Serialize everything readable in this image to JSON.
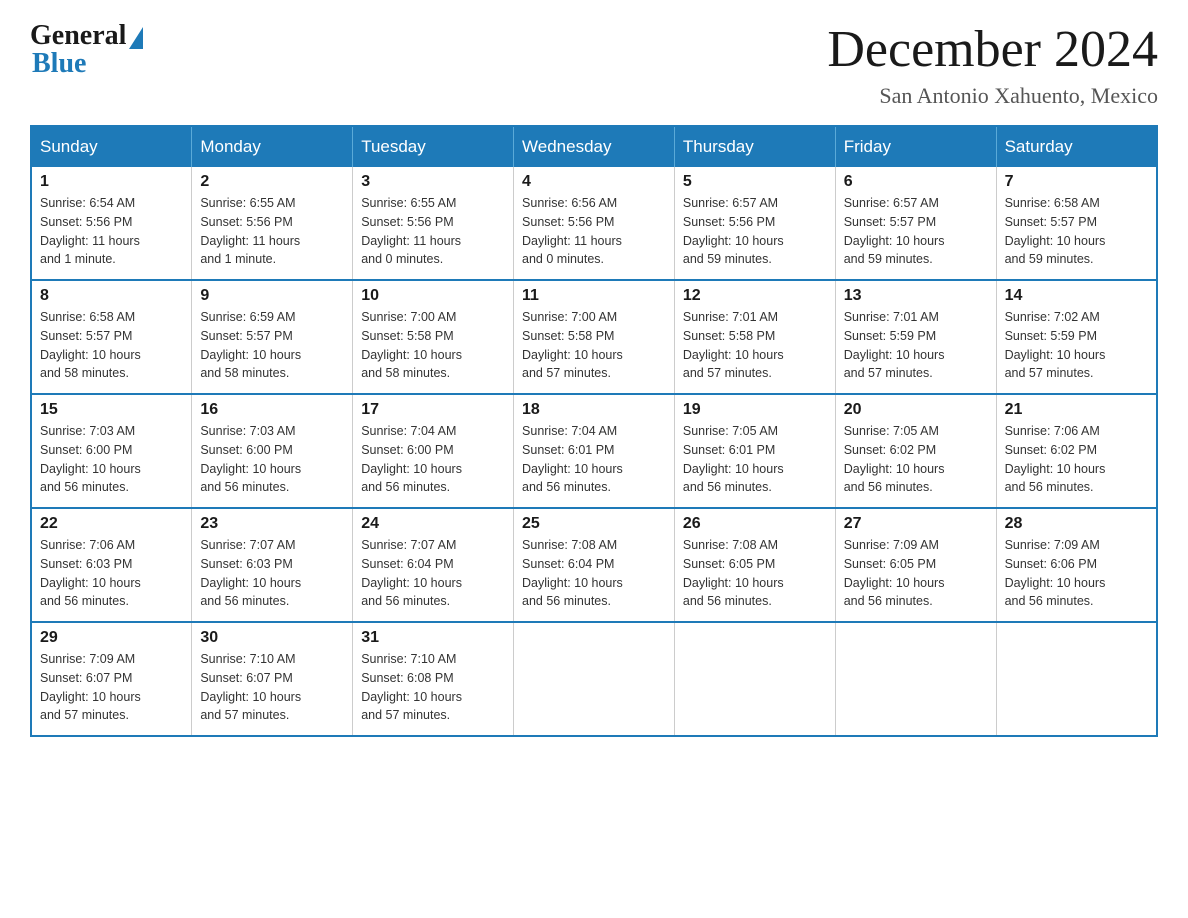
{
  "logo": {
    "general": "General",
    "blue": "Blue"
  },
  "title": {
    "month": "December 2024",
    "location": "San Antonio Xahuento, Mexico"
  },
  "headers": [
    "Sunday",
    "Monday",
    "Tuesday",
    "Wednesday",
    "Thursday",
    "Friday",
    "Saturday"
  ],
  "weeks": [
    [
      {
        "day": "1",
        "sunrise": "6:54 AM",
        "sunset": "5:56 PM",
        "daylight": "11 hours and 1 minute."
      },
      {
        "day": "2",
        "sunrise": "6:55 AM",
        "sunset": "5:56 PM",
        "daylight": "11 hours and 1 minute."
      },
      {
        "day": "3",
        "sunrise": "6:55 AM",
        "sunset": "5:56 PM",
        "daylight": "11 hours and 0 minutes."
      },
      {
        "day": "4",
        "sunrise": "6:56 AM",
        "sunset": "5:56 PM",
        "daylight": "11 hours and 0 minutes."
      },
      {
        "day": "5",
        "sunrise": "6:57 AM",
        "sunset": "5:56 PM",
        "daylight": "10 hours and 59 minutes."
      },
      {
        "day": "6",
        "sunrise": "6:57 AM",
        "sunset": "5:57 PM",
        "daylight": "10 hours and 59 minutes."
      },
      {
        "day": "7",
        "sunrise": "6:58 AM",
        "sunset": "5:57 PM",
        "daylight": "10 hours and 59 minutes."
      }
    ],
    [
      {
        "day": "8",
        "sunrise": "6:58 AM",
        "sunset": "5:57 PM",
        "daylight": "10 hours and 58 minutes."
      },
      {
        "day": "9",
        "sunrise": "6:59 AM",
        "sunset": "5:57 PM",
        "daylight": "10 hours and 58 minutes."
      },
      {
        "day": "10",
        "sunrise": "7:00 AM",
        "sunset": "5:58 PM",
        "daylight": "10 hours and 58 minutes."
      },
      {
        "day": "11",
        "sunrise": "7:00 AM",
        "sunset": "5:58 PM",
        "daylight": "10 hours and 57 minutes."
      },
      {
        "day": "12",
        "sunrise": "7:01 AM",
        "sunset": "5:58 PM",
        "daylight": "10 hours and 57 minutes."
      },
      {
        "day": "13",
        "sunrise": "7:01 AM",
        "sunset": "5:59 PM",
        "daylight": "10 hours and 57 minutes."
      },
      {
        "day": "14",
        "sunrise": "7:02 AM",
        "sunset": "5:59 PM",
        "daylight": "10 hours and 57 minutes."
      }
    ],
    [
      {
        "day": "15",
        "sunrise": "7:03 AM",
        "sunset": "6:00 PM",
        "daylight": "10 hours and 56 minutes."
      },
      {
        "day": "16",
        "sunrise": "7:03 AM",
        "sunset": "6:00 PM",
        "daylight": "10 hours and 56 minutes."
      },
      {
        "day": "17",
        "sunrise": "7:04 AM",
        "sunset": "6:00 PM",
        "daylight": "10 hours and 56 minutes."
      },
      {
        "day": "18",
        "sunrise": "7:04 AM",
        "sunset": "6:01 PM",
        "daylight": "10 hours and 56 minutes."
      },
      {
        "day": "19",
        "sunrise": "7:05 AM",
        "sunset": "6:01 PM",
        "daylight": "10 hours and 56 minutes."
      },
      {
        "day": "20",
        "sunrise": "7:05 AM",
        "sunset": "6:02 PM",
        "daylight": "10 hours and 56 minutes."
      },
      {
        "day": "21",
        "sunrise": "7:06 AM",
        "sunset": "6:02 PM",
        "daylight": "10 hours and 56 minutes."
      }
    ],
    [
      {
        "day": "22",
        "sunrise": "7:06 AM",
        "sunset": "6:03 PM",
        "daylight": "10 hours and 56 minutes."
      },
      {
        "day": "23",
        "sunrise": "7:07 AM",
        "sunset": "6:03 PM",
        "daylight": "10 hours and 56 minutes."
      },
      {
        "day": "24",
        "sunrise": "7:07 AM",
        "sunset": "6:04 PM",
        "daylight": "10 hours and 56 minutes."
      },
      {
        "day": "25",
        "sunrise": "7:08 AM",
        "sunset": "6:04 PM",
        "daylight": "10 hours and 56 minutes."
      },
      {
        "day": "26",
        "sunrise": "7:08 AM",
        "sunset": "6:05 PM",
        "daylight": "10 hours and 56 minutes."
      },
      {
        "day": "27",
        "sunrise": "7:09 AM",
        "sunset": "6:05 PM",
        "daylight": "10 hours and 56 minutes."
      },
      {
        "day": "28",
        "sunrise": "7:09 AM",
        "sunset": "6:06 PM",
        "daylight": "10 hours and 56 minutes."
      }
    ],
    [
      {
        "day": "29",
        "sunrise": "7:09 AM",
        "sunset": "6:07 PM",
        "daylight": "10 hours and 57 minutes."
      },
      {
        "day": "30",
        "sunrise": "7:10 AM",
        "sunset": "6:07 PM",
        "daylight": "10 hours and 57 minutes."
      },
      {
        "day": "31",
        "sunrise": "7:10 AM",
        "sunset": "6:08 PM",
        "daylight": "10 hours and 57 minutes."
      },
      null,
      null,
      null,
      null
    ]
  ],
  "labels": {
    "sunrise": "Sunrise:",
    "sunset": "Sunset:",
    "daylight": "Daylight:"
  }
}
